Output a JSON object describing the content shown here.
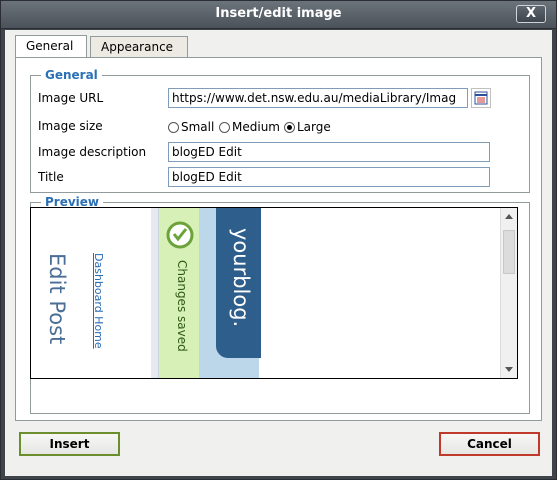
{
  "window": {
    "title": "Insert/edit image",
    "close_label": "X"
  },
  "tabs": [
    {
      "label": "General",
      "active": true
    },
    {
      "label": "Appearance",
      "active": false
    }
  ],
  "general": {
    "legend": "General",
    "image_url_label": "Image URL",
    "image_url_value": "https://www.det.nsw.edu.au/mediaLibrary/Imag",
    "image_size_label": "Image size",
    "size_options": [
      {
        "label": "Small",
        "selected": false
      },
      {
        "label": "Medium",
        "selected": false
      },
      {
        "label": "Large",
        "selected": true
      }
    ],
    "image_description_label": "Image description",
    "image_description_value": "blogED Edit",
    "title_label": "Title",
    "title_value": "blogED Edit"
  },
  "preview": {
    "legend": "Preview",
    "image_texts": {
      "edit_post": "Edit Post",
      "dashboard_home": "Dashboard Home",
      "changes_saved": "Changes saved",
      "yourblog": "yourblog."
    }
  },
  "buttons": {
    "insert": "Insert",
    "cancel": "Cancel"
  },
  "colors": {
    "accent": "#2b6fb6",
    "insert_border": "#6a8f2c",
    "cancel_border": "#c0392b",
    "saved_green": "#d6f0b8"
  }
}
